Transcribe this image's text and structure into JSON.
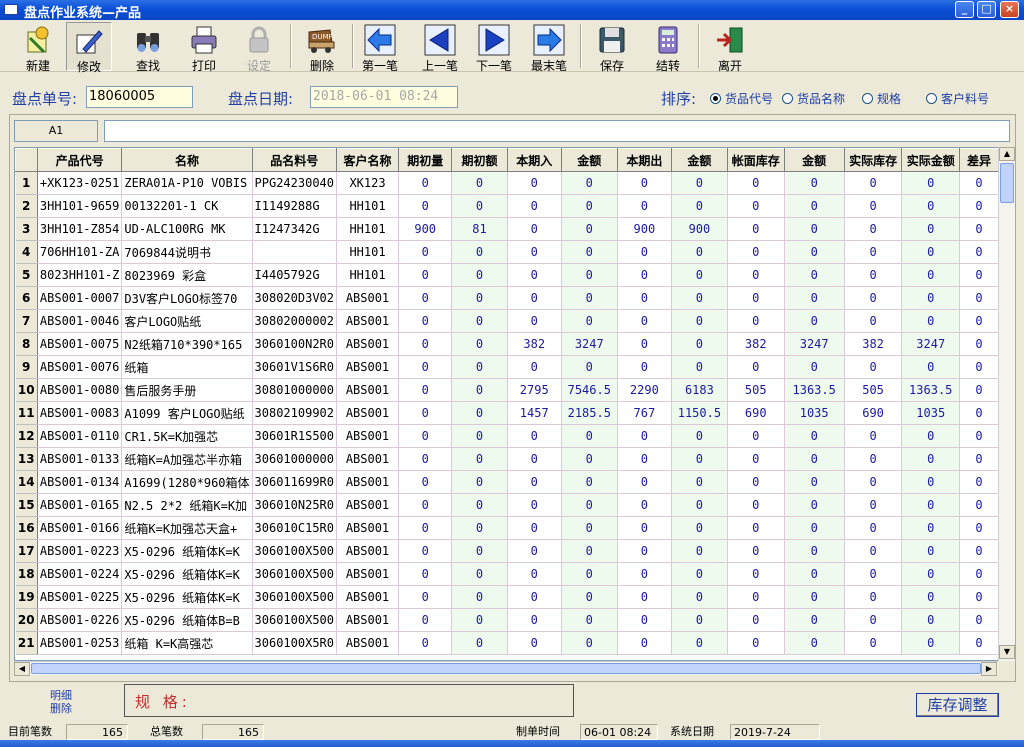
{
  "window": {
    "title": "盘点作业系统—产品"
  },
  "toolbar": {
    "new": "新建",
    "edit": "修改",
    "find": "查找",
    "print": "打印",
    "settings": "设定",
    "delete": "删除",
    "dump_text": "DUMP",
    "first": "第一笔",
    "prev": "上一笔",
    "next": "下一笔",
    "last": "最末笔",
    "save": "保存",
    "carry": "结转",
    "exit": "离开"
  },
  "header": {
    "order_no_label": "盘点单号:",
    "order_no": "18060005",
    "date_label": "盘点日期:",
    "date": "2018-06-01 08:24",
    "sort_label": "排序:",
    "sort_options": [
      {
        "label": "货品代号",
        "selected": true
      },
      {
        "label": "货品名称",
        "selected": false
      },
      {
        "label": "规格",
        "selected": false
      },
      {
        "label": "客户料号",
        "selected": false
      }
    ]
  },
  "cellref": "A1",
  "grid": {
    "columns": [
      "",
      "产品代号",
      "名称",
      "品名料号",
      "客户名称",
      "期初量",
      "期初额",
      "本期入",
      "金额",
      "本期出",
      "金额",
      "帐面库存",
      "金额",
      "实际库存",
      "实际金额",
      "差异"
    ],
    "rows": [
      [
        "1",
        "+XK123-0251",
        "ZERA01A-P10 VOBIS",
        "PPG24230040",
        "XK123",
        "0",
        "0",
        "0",
        "0",
        "0",
        "0",
        "0",
        "0",
        "0",
        "0",
        "0"
      ],
      [
        "2",
        "3HH101-9659",
        "00132201-1 CK",
        "I1149288G",
        "HH101",
        "0",
        "0",
        "0",
        "0",
        "0",
        "0",
        "0",
        "0",
        "0",
        "0",
        "0"
      ],
      [
        "3",
        "3HH101-Z854",
        "UD-ALC100RG MK",
        "I1247342G",
        "HH101",
        "900",
        "81",
        "0",
        "0",
        "900",
        "900",
        "0",
        "0",
        "0",
        "0",
        "0"
      ],
      [
        "4",
        "706HH101-ZA",
        "7069844说明书",
        "",
        "HH101",
        "0",
        "0",
        "0",
        "0",
        "0",
        "0",
        "0",
        "0",
        "0",
        "0",
        "0"
      ],
      [
        "5",
        "8023HH101-Z",
        "8023969 彩盒",
        "I4405792G",
        "HH101",
        "0",
        "0",
        "0",
        "0",
        "0",
        "0",
        "0",
        "0",
        "0",
        "0",
        "0"
      ],
      [
        "6",
        "ABS001-0007",
        "D3V客户LOGO标签70",
        "308020D3V02",
        "ABS001",
        "0",
        "0",
        "0",
        "0",
        "0",
        "0",
        "0",
        "0",
        "0",
        "0",
        "0"
      ],
      [
        "7",
        "ABS001-0046",
        "客户LOGO贴纸",
        "30802000002",
        "ABS001",
        "0",
        "0",
        "0",
        "0",
        "0",
        "0",
        "0",
        "0",
        "0",
        "0",
        "0"
      ],
      [
        "8",
        "ABS001-0075",
        "N2纸箱710*390*165",
        "3060100N2R0",
        "ABS001",
        "0",
        "0",
        "382",
        "3247",
        "0",
        "0",
        "382",
        "3247",
        "382",
        "3247",
        "0"
      ],
      [
        "9",
        "ABS001-0076",
        "纸箱",
        "30601V1S6R0",
        "ABS001",
        "0",
        "0",
        "0",
        "0",
        "0",
        "0",
        "0",
        "0",
        "0",
        "0",
        "0"
      ],
      [
        "10",
        "ABS001-0080",
        "售后服务手册",
        "30801000000",
        "ABS001",
        "0",
        "0",
        "2795",
        "7546.5",
        "2290",
        "6183",
        "505",
        "1363.5",
        "505",
        "1363.5",
        "0"
      ],
      [
        "11",
        "ABS001-0083",
        "A1099 客户LOGO贴纸",
        "30802109902",
        "ABS001",
        "0",
        "0",
        "1457",
        "2185.5",
        "767",
        "1150.5",
        "690",
        "1035",
        "690",
        "1035",
        "0"
      ],
      [
        "12",
        "ABS001-0110",
        "CR1.5K=K加强芯",
        "30601R1S500",
        "ABS001",
        "0",
        "0",
        "0",
        "0",
        "0",
        "0",
        "0",
        "0",
        "0",
        "0",
        "0"
      ],
      [
        "13",
        "ABS001-0133",
        "纸箱K=A加强芯半亦箱",
        "30601000000",
        "ABS001",
        "0",
        "0",
        "0",
        "0",
        "0",
        "0",
        "0",
        "0",
        "0",
        "0",
        "0"
      ],
      [
        "14",
        "ABS001-0134",
        "A1699(1280*960箱体",
        "306011699R0",
        "ABS001",
        "0",
        "0",
        "0",
        "0",
        "0",
        "0",
        "0",
        "0",
        "0",
        "0",
        "0"
      ],
      [
        "15",
        "ABS001-0165",
        "N2.5 2*2 纸箱K=K加",
        "306010N25R0",
        "ABS001",
        "0",
        "0",
        "0",
        "0",
        "0",
        "0",
        "0",
        "0",
        "0",
        "0",
        "0"
      ],
      [
        "16",
        "ABS001-0166",
        "纸箱K=K加强芯天盒+",
        "306010C15R0",
        "ABS001",
        "0",
        "0",
        "0",
        "0",
        "0",
        "0",
        "0",
        "0",
        "0",
        "0",
        "0"
      ],
      [
        "17",
        "ABS001-0223",
        "X5-0296 纸箱体K=K",
        "3060100X500",
        "ABS001",
        "0",
        "0",
        "0",
        "0",
        "0",
        "0",
        "0",
        "0",
        "0",
        "0",
        "0"
      ],
      [
        "18",
        "ABS001-0224",
        "X5-0296 纸箱体K=K",
        "3060100X500",
        "ABS001",
        "0",
        "0",
        "0",
        "0",
        "0",
        "0",
        "0",
        "0",
        "0",
        "0",
        "0"
      ],
      [
        "19",
        "ABS001-0225",
        "X5-0296 纸箱体K=K",
        "3060100X500",
        "ABS001",
        "0",
        "0",
        "0",
        "0",
        "0",
        "0",
        "0",
        "0",
        "0",
        "0",
        "0"
      ],
      [
        "20",
        "ABS001-0226",
        "X5-0296 纸箱体B=B",
        "3060100X500",
        "ABS001",
        "0",
        "0",
        "0",
        "0",
        "0",
        "0",
        "0",
        "0",
        "0",
        "0",
        "0"
      ],
      [
        "21",
        "ABS001-0253",
        "纸箱  K=K高强芯",
        "3060100X5R0",
        "ABS001",
        "0",
        "0",
        "0",
        "0",
        "0",
        "0",
        "0",
        "0",
        "0",
        "0",
        "0"
      ]
    ]
  },
  "bottom": {
    "detail_delete": "明细删除",
    "spec_label": "规  格:",
    "adjust_button": "库存调整"
  },
  "status": {
    "current_label": "目前笔数",
    "current": "165",
    "total_label": "总笔数",
    "total": "165",
    "made_time_label": "制单时间",
    "made_time": "06-01 08:24",
    "sys_date_label": "系统日期",
    "sys_date": "2019-7-24"
  },
  "colors": {
    "accent": "#1f3fa6",
    "title_bar": "#0a4fd6",
    "field_bg": "#ffffe0",
    "numbers": "#1a1aa0"
  }
}
